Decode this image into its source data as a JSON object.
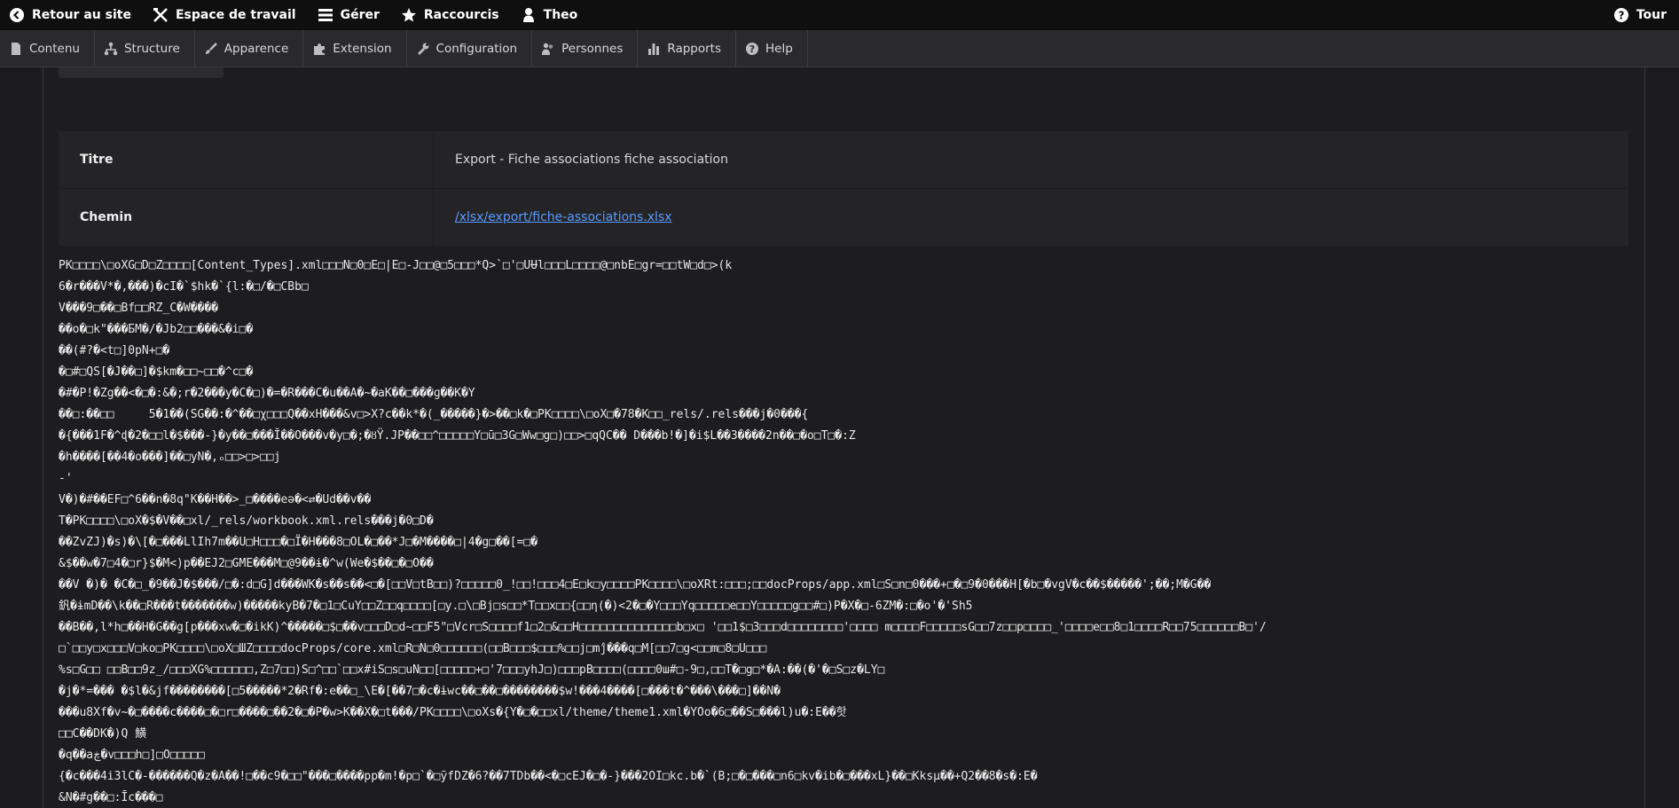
{
  "toolbar": {
    "back": "Retour au site",
    "workspace": "Espace de travail",
    "manage": "Gérer",
    "shortcuts": "Raccourcis",
    "user": "Theo",
    "tour": "Tour"
  },
  "tray": [
    {
      "label": "Contenu",
      "icon": "file-icon"
    },
    {
      "label": "Structure",
      "icon": "sitemap-icon"
    },
    {
      "label": "Apparence",
      "icon": "brush-icon"
    },
    {
      "label": "Extension",
      "icon": "puzzle-icon"
    },
    {
      "label": "Configuration",
      "icon": "wrench-icon"
    },
    {
      "label": "Personnes",
      "icon": "people-icon"
    },
    {
      "label": "Rapports",
      "icon": "chart-icon"
    },
    {
      "label": "Help",
      "icon": "help-icon"
    }
  ],
  "info": {
    "title_label": "Titre",
    "title_value": "Export - Fiche associations fiche association",
    "path_label": "Chemin",
    "path_value": "/xlsx/export/fiche-associations.xlsx"
  },
  "raw_lines": [
    "PK□□□□\\□oXG□D□Z□□□□[Content_Types].xml□□□N□0□E□|E□-J□□@□5□□□*Q>`□'□UɄl□□□L□□□□@□nbE□gr=□□tW□d□>(k",
    "6�r���V*�,���)�cI�`$hk�`{l:�□/�□CBb□",
    "V���9□��□Bf□□RZ_C�W����",
    "��o�□k\"���БM�/�Jb2□□���&�i□�",
    "��(#?�<t□]0pN+□�",
    "�□#□QS[�J��□]�$km�□□~□□�^c□�",
    "�#�P!�Zg��<�□�:&�;r�2���y�C�□)�=�R���C�u��A�~�aK��□���ɡ��K�Y",
    "��□:��□□     5�1��(SG��:�^��□χ□□□Q��xH���&v□>X?c��k*�(_�����}�>��□k�□PK□□□□\\□oX□�78�K□□_rels/.rels���j�0���{",
    "�{���1F�^ɖ�2�□□l�$���-}�y��□���Ĭ��O���v�y□�;�ȣŸ.JP��□□^□□□□□Y□ū□3G□Ww□g□)□□>□qQC�� D���b!�]�i$L��3����2n��□�o□T□�:Z",
    "�h����[��4�o���]��□yN�,ₒ□□>□>□□j",
    "-'",
    "V�)�#��EF□^6��n�8q\"K��H��>_□����eə�<⇄�Ud��v��",
    "T�PK□□□□\\□oX�$�V��□xl/_rels/workbook.xml.rels���j�0□D�",
    "��ZvZJ)�s)�\\[�□���LlIh7m��U□H□□□�□Ï�H���8□OL�□��*J□�M����□|4�g□��[=□�",
    "&$��w�7□4�□r}$�M<)p��EJ2□GME���M□@9��ɨ�^w(We�$��□�□O��",
    "��V �)� �C�□_�9��J�$���/□�:d□G]d���WK�s��s��<□�[□□V□tB□□)?□□□□□0_!□□!□□□4□E□k□y□□□□PK□□□□\\□oXRt:□□□;□□docProps/app.xml□S□n□0���+□�□9�0���H[�b□�vgV�c��$�����';��;M�G��",
    "釩�ɨmD��\\k��□R���t�������w)�����kyB�7�□1□CuY□□Z□□q□□□□[□y.□\\□Bj□s□□*T□□x□□{□□η(�)<2�□�Y□□□Yq□□□□□e□□Y□□□□□g□□#□)P�X�□-6ZM�:□�o'�'Sh5",
    "��B��,l*h□��H�G��g[p���xw�□�іkK)^�����□$□��v□□□D□d~□□F5\"□Vcr□S□□□□f1□2□&□□H□□□□□□□□□□□□□□b□x□ '□□1$□3□□□d□□□□□□□□'□□□□ m□□□□F□□□□□sG□□7z□□p□□□□_'□□□□e□□8□1□□□□R□□75□□□□□□B□'/",
    "□`□□y□х□□□V□ko□PK□□□□\\□oX□ШZ□□□□docProps/core.xml□R□N□0□□□□□□(□□B□□□$□□□%□□j□mĵ���q□M[□□7□g<□□m□8□U□□□",
    "%s□G□□ □□B□□9z_/□□□XG%□□□□□□,Z□7□□)S□^□□`□□x#iS□s□uN□□[□□□□□+□'7□□□yhJ□)□□□pB□□□□(□□□□0ա#□-9□,□□T�□g□*�A:��(�'�□S□z�LY□",
    "�j�*=��� �$l�&jf��������[□5�����*2�Rf�:e��□_\\E�[��7□�c�ɨwc��□��□��������$w!���4����[□���t�^���\\���□]��N�",
    "���u8Xf�v~�□����c����□�□r□����□��2�□�P�w>K��X�□t���/PK□□□□\\□oXs�{Y�□�□□xl/theme/theme1.xml�YOo�6□��S□���l)u�:E��핫",
    "□□C��DK�)Q 鱑",
    "�q��aڿ�v□□□h□]□O□□□□□",
    "{�c���4i3lC�-������Q�z�A��!□��c9�□□\"���□����pp�m!�p□`�□ȳfDZ�6?��7TDb��<�□cEJ�□�-}���2OI□kc.b�`(B;□�□���□n6□kv�ib�□���xL}��□Kksµ��+Q2��8�s�:E�",
    "&N�#g��□:Īc���□"
  ]
}
